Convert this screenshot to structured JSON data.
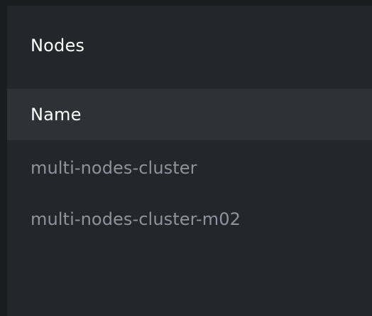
{
  "panel": {
    "title": "Nodes"
  },
  "table": {
    "columns": [
      "Name"
    ],
    "rows": [
      {
        "name": "multi-nodes-cluster"
      },
      {
        "name": "multi-nodes-cluster-m02"
      }
    ]
  },
  "colors": {
    "background": "#1b1c20",
    "panel": "#24262c",
    "header_row": "#303137",
    "title_text": "#ffffff",
    "row_text": "#8f939e"
  }
}
